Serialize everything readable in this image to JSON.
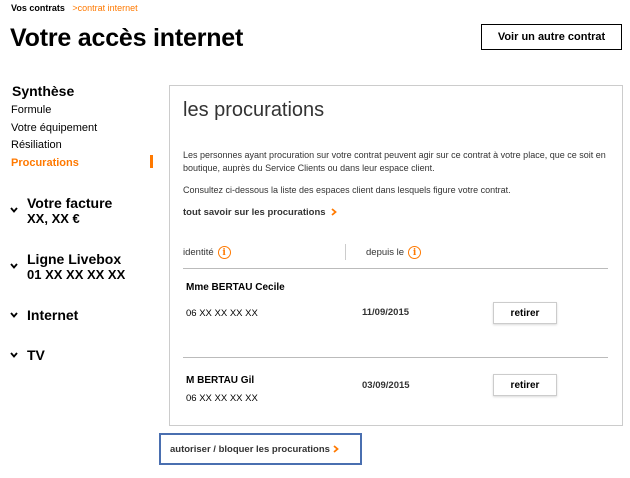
{
  "breadcrumb": {
    "first": "Vos contrats",
    "separator": ">",
    "current": "contrat internet"
  },
  "header": {
    "title": "Votre accès internet",
    "other_contract_button": "Voir un autre contrat"
  },
  "sidebar": {
    "section_title": "Synthèse",
    "links": [
      {
        "label": "Formule"
      },
      {
        "label": "Votre équipement"
      },
      {
        "label": "Résiliation"
      },
      {
        "label": "Procurations",
        "active": true
      }
    ],
    "groups": [
      {
        "title": "Votre facture",
        "value": "XX, XX €"
      },
      {
        "title": "Ligne Livebox",
        "value": "01 XX XX XX XX"
      },
      {
        "title": "Internet",
        "value": ""
      },
      {
        "title": "TV",
        "value": ""
      }
    ]
  },
  "panel": {
    "title": "les procurations",
    "paragraph1": "Les personnes ayant procuration sur votre contrat peuvent agir sur ce contrat à votre place, que ce soit en boutique, auprès du Service Clients ou dans leur espace client.",
    "paragraph2": "Consultez ci-dessous la liste des espaces client dans lesquels figure votre contrat.",
    "more_link": "tout savoir sur les procurations",
    "columns": {
      "identity": "identité",
      "since": "depuis le",
      "info_icon": "i"
    },
    "rows": [
      {
        "name": "Mme BERTAU Cecile",
        "phone": "06 XX XX XX XX",
        "date": "11/09/2015",
        "action": "retirer"
      },
      {
        "name": "M BERTAU Gil",
        "phone": "06 XX XX XX XX",
        "date": "03/09/2015",
        "action": "retirer"
      }
    ]
  },
  "footer": {
    "authorize_link": "autoriser / bloquer les procurations"
  },
  "colors": {
    "accent": "#ff7900",
    "highlight_box": "#4a6fb0",
    "border": "#cccccc"
  }
}
